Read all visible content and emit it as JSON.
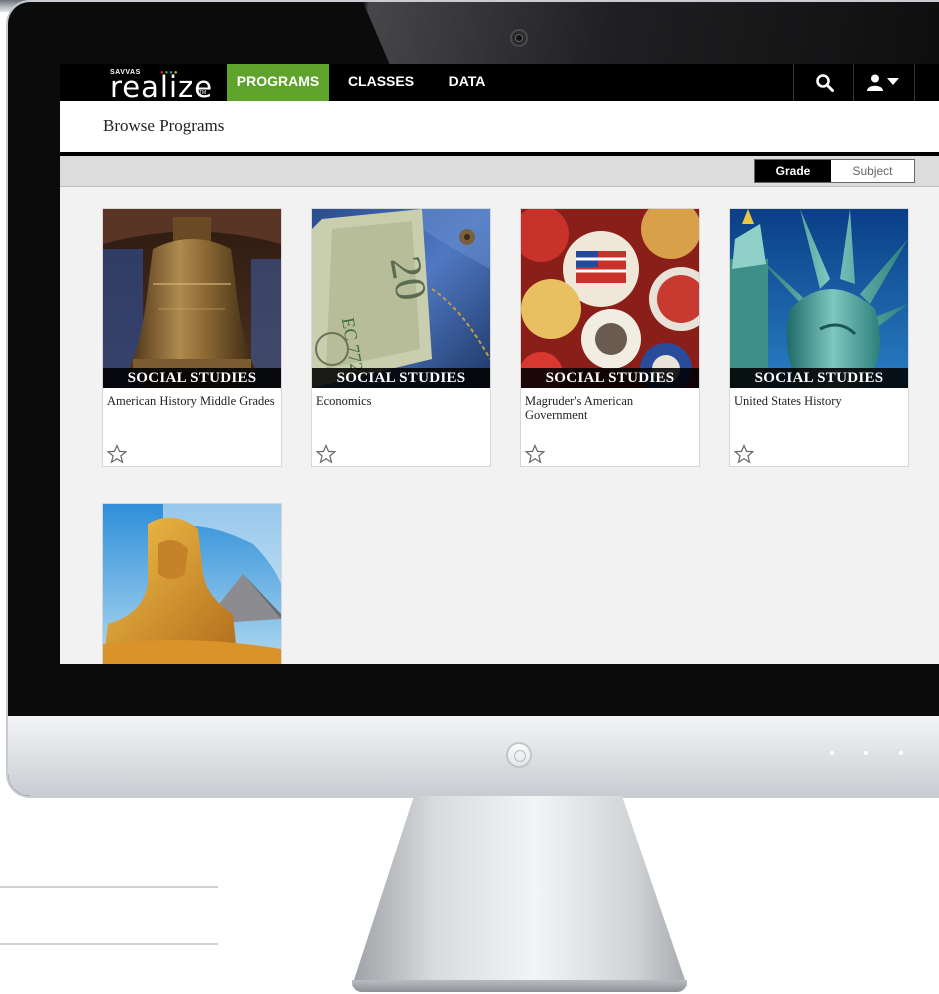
{
  "app": {
    "logo_brand": "SAVVAS",
    "logo_name": "realize"
  },
  "nav": {
    "items": [
      {
        "label": "PROGRAMS",
        "active": true
      },
      {
        "label": "CLASSES",
        "active": false
      },
      {
        "label": "DATA",
        "active": false
      }
    ],
    "search_icon": "search-icon",
    "user_icon": "user-menu-icon"
  },
  "page": {
    "title": "Browse Programs"
  },
  "filter": {
    "options": [
      "Grade",
      "Subject"
    ],
    "selected": "Grade"
  },
  "programs": [
    {
      "subject": "SOCIAL STUDIES",
      "title": "American History Middle Grades",
      "image": "liberty-bell"
    },
    {
      "subject": "SOCIAL STUDIES",
      "title": "Economics",
      "image": "dollar-bill-jeans"
    },
    {
      "subject": "SOCIAL STUDIES",
      "title": "Magruder's American Government",
      "image": "campaign-buttons"
    },
    {
      "subject": "SOCIAL STUDIES",
      "title": "United States History",
      "image": "statue-of-liberty"
    },
    {
      "subject": "",
      "title": "",
      "image": "sphinx-pyramid"
    }
  ],
  "colors": {
    "nav_bg": "#000000",
    "active_tab": "#5ea32a",
    "content_bg": "#f2f2f2",
    "toolbar_bg": "#dcdcdc"
  }
}
